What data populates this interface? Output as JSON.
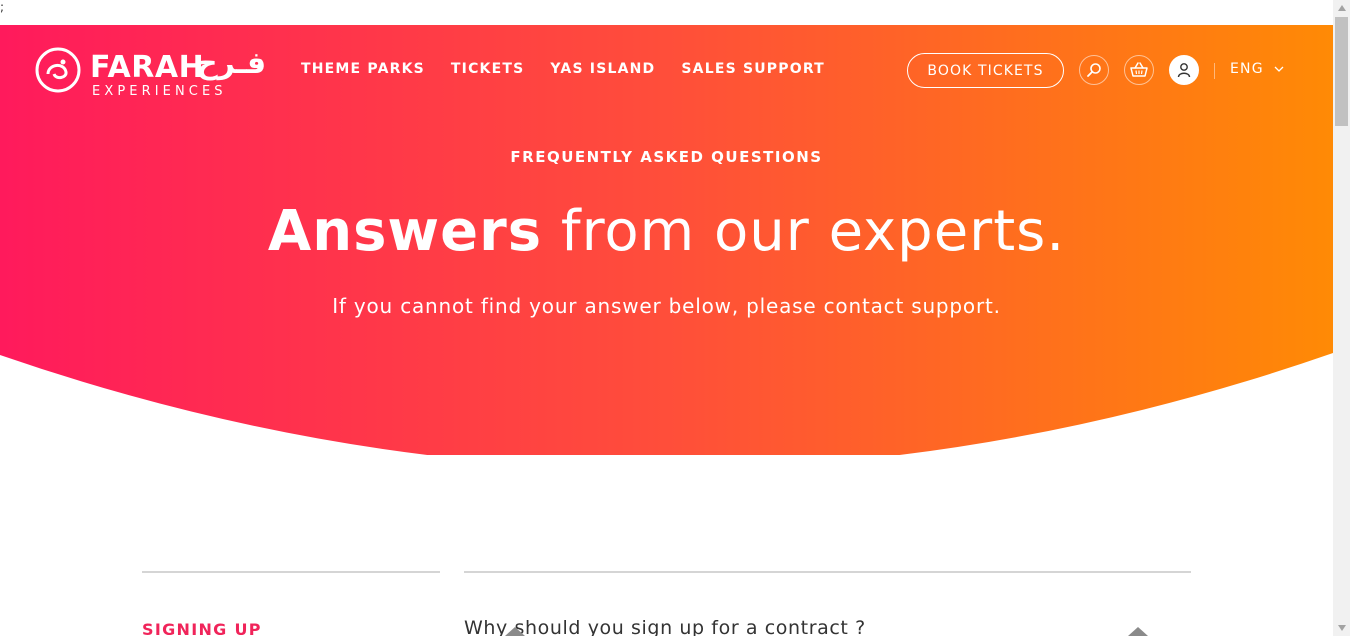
{
  "stray_text": ";",
  "brand": {
    "logo_word": "FARAH",
    "logo_sub": "EXPERIENCES",
    "logo_arabic": "فـرح"
  },
  "nav": {
    "items": [
      {
        "label": "THEME PARKS"
      },
      {
        "label": "TICKETS"
      },
      {
        "label": "YAS ISLAND"
      },
      {
        "label": "SALES SUPPORT"
      }
    ],
    "book_label": "BOOK TICKETS",
    "language": "ENG"
  },
  "hero": {
    "eyebrow": "FREQUENTLY ASKED QUESTIONS",
    "headline_strong": "Answers",
    "headline_light": " from our experts.",
    "subline": "If you cannot find your answer below, please contact support."
  },
  "faq": {
    "category": "SIGNING UP",
    "question": "Why should you sign up for a contract ?"
  },
  "colors": {
    "gradient_start": "#ff1a5c",
    "gradient_end": "#ff8a05",
    "accent": "#f0245a"
  },
  "icons": {
    "search": "search-icon",
    "cart": "basket-icon",
    "user": "user-icon",
    "chevron": "chevron-down-icon"
  }
}
